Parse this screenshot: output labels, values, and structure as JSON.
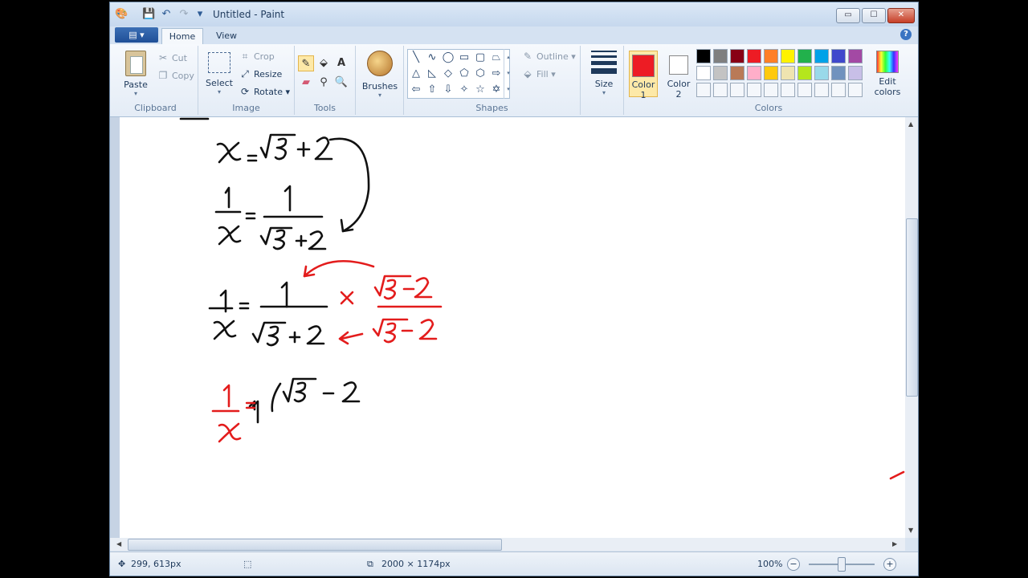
{
  "window": {
    "title": "Untitled - Paint",
    "buttons": {
      "minimize": "▭",
      "maximize": "☐",
      "close": "✕"
    }
  },
  "quick_access": {
    "save_icon": "💾",
    "undo_icon": "↶",
    "redo_icon": "↷",
    "customize_icon": "▾"
  },
  "tabs": {
    "home": "Home",
    "view": "View",
    "help": "?"
  },
  "ribbon": {
    "clipboard": {
      "title": "Clipboard",
      "paste": "Paste",
      "cut": "Cut",
      "copy": "Copy"
    },
    "image": {
      "title": "Image",
      "select": "Select",
      "crop": "Crop",
      "resize": "Resize",
      "rotate": "Rotate"
    },
    "tools": {
      "title": "Tools",
      "text_tool": "A"
    },
    "brushes": {
      "label": "Brushes"
    },
    "shapes": {
      "title": "Shapes",
      "outline": "Outline",
      "fill": "Fill"
    },
    "size": {
      "label": "Size"
    },
    "colors": {
      "title": "Colors",
      "color1_label": "Color",
      "color1_num": "1",
      "color2_label": "Color",
      "color2_num": "2",
      "color1": "#ed1c24",
      "color2": "#ffffff",
      "edit_colors": "Edit",
      "edit_colors_2": "colors",
      "palette_row1": [
        "#000000",
        "#7f7f7f",
        "#880015",
        "#ed1c24",
        "#ff7f27",
        "#fff200",
        "#22b14c",
        "#00a2e8",
        "#3f48cc",
        "#a349a4"
      ],
      "palette_row2": [
        "#ffffff",
        "#c3c3c3",
        "#b97a57",
        "#ffaec9",
        "#ffc90e",
        "#efe4b0",
        "#b5e61d",
        "#99d9ea",
        "#7092be",
        "#c8bfe7"
      ]
    }
  },
  "status": {
    "cursor_pos": "299, 613px",
    "canvas_size": "2000 × 1174px",
    "zoom": "100%",
    "zoom_out": "−",
    "zoom_in": "+"
  },
  "ink_color_black": "#111111",
  "ink_color_red": "#e31c1c"
}
